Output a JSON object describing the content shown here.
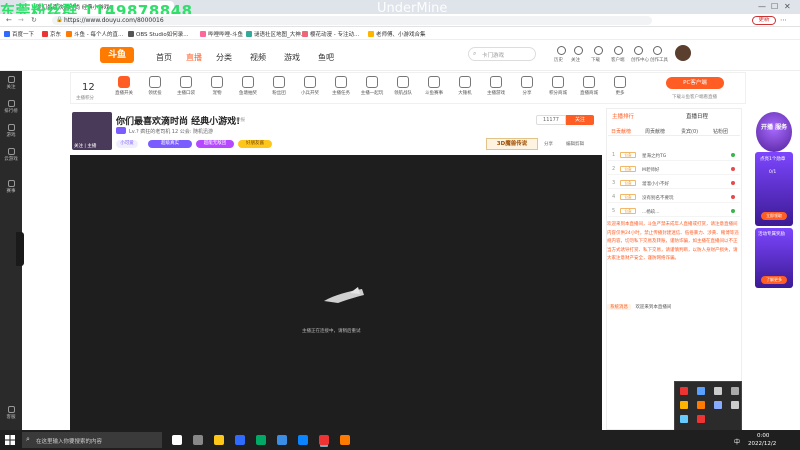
{
  "browser": {
    "overlay_text": "东莞粉丝群 1149878848",
    "overlay_title": "UnderMine",
    "tab_title": "你们最喜欢滴时尚 经典小游戏!",
    "url": "https://www.douyu.com/8000016",
    "update_label": "更新",
    "bookmarks": [
      "百度一下",
      "京东",
      "斗鱼 - 每个人的直...",
      "OBS Studio如何录...",
      "哔哩哔哩-斗鱼",
      "谜语社区地图_大神...",
      "樱花动漫 - 专注动...",
      "老师傅、小游戏合集"
    ]
  },
  "header": {
    "logo": "斗鱼",
    "nav": [
      "首页",
      "直播",
      "分类",
      "视频",
      "游戏",
      "鱼吧"
    ],
    "nav_active_index": 1,
    "search_placeholder": "卡门游戏",
    "icons": [
      {
        "icon": "bell-icon",
        "label": "历史"
      },
      {
        "icon": "heart-icon",
        "label": "关注"
      },
      {
        "icon": "download-icon",
        "label": "下载"
      },
      {
        "icon": "mail-icon",
        "label": "客户端"
      },
      {
        "icon": "cart-icon",
        "label": "创作中心"
      },
      {
        "icon": "bulb-icon",
        "label": "创作工具"
      }
    ]
  },
  "sidebar": [
    {
      "icon": "heart-icon",
      "label": "关注"
    },
    {
      "icon": "clock-icon",
      "label": "排行榜"
    },
    {
      "icon": "tv-icon",
      "label": "游戏"
    },
    {
      "icon": "gamepad-icon",
      "label": "云游戏"
    },
    {
      "icon": "trophy-icon",
      "label": "赛事"
    },
    {
      "icon": "user-icon",
      "label": "客服"
    }
  ],
  "toolbar": {
    "level": "12",
    "level_label": "主播积分",
    "items": [
      "直播开关",
      "领优投",
      "主播口袋",
      "宠物",
      "鱼塘抽奖",
      "粉丝团",
      "小兵开奖",
      "主播任务",
      "主播一起玩",
      "领航战队",
      "斗鱼赛事",
      "大锤机",
      "主播游戏",
      "分享",
      "积分商城",
      "直播商城",
      "更多"
    ],
    "pc_button": "PC客户端",
    "pc_sub": "下载斗鱼客户端看直播"
  },
  "room": {
    "title": "你们最喜欢滴时尚 经典小游戏!",
    "report": "举报",
    "meta": "Lv.? 疯狂的老司机  12  公会: 随机迅游",
    "anchor_tag": "关注  |  主播",
    "tags": [
      "小可爱",
      "超级真实",
      "超能无敌团",
      "好朋友酱"
    ],
    "follow_count": "11177",
    "follow_label": "关注",
    "game_logo": "3D魔兽传说",
    "share_label": "分享",
    "clip_label": "编辑剪辑"
  },
  "player": {
    "loading_text": "主播正在连接中，请稍后重试"
  },
  "rank_panel": {
    "title": "主播排行",
    "right_title": "直播日程",
    "tabs": [
      "日贡献榜",
      "周贡献榜",
      "贵宾(0)",
      "钻粉团"
    ],
    "rows": [
      {
        "num": "1",
        "badge": "公会",
        "name": "星海之约TG",
        "dot": "#3ab54a"
      },
      {
        "num": "2",
        "badge": "公会",
        "name": "M老师好",
        "dot": "#e54b4b"
      },
      {
        "num": "3",
        "badge": "公会",
        "name": "溜溜小小不好",
        "dot": "#e54b4b"
      },
      {
        "num": "4",
        "badge": "公会",
        "name": "没有别名不要玩",
        "dot": "#e54b4b"
      },
      {
        "num": "5",
        "badge": "公会",
        "name": "...杨玖...",
        "dot": "#3ab54a"
      }
    ],
    "notice": "欢迎来到本直播间，斗鱼严禁未成年人直播或打赏，请注意直播间内容仅供24小时，禁止传播封建迷信、低俗暴力、涉黄、赌博等违规内容，切勿私下交易及转账，谨防诈骗，如主播在直播间以不正当方式诱导打赏、私下交易，请谨慎判断，以防人身财产损失，请大家注意财产安全，谨防网络诈骗。",
    "sys_tag": "系统消息",
    "sys_msg": "欢迎来到本直播间"
  },
  "ads": {
    "ad1": "开播 服务",
    "ad2_title": "点亮1个勋章",
    "ad2_sub": "0/1",
    "ad2_btn": "立即领取",
    "ad3_title": "活动专属奖励",
    "ad3_btn": "了解更多"
  },
  "taskbar": {
    "search_placeholder": "在这里输入你要搜索的内容",
    "time": "0:00",
    "date": "2022/12/2"
  }
}
